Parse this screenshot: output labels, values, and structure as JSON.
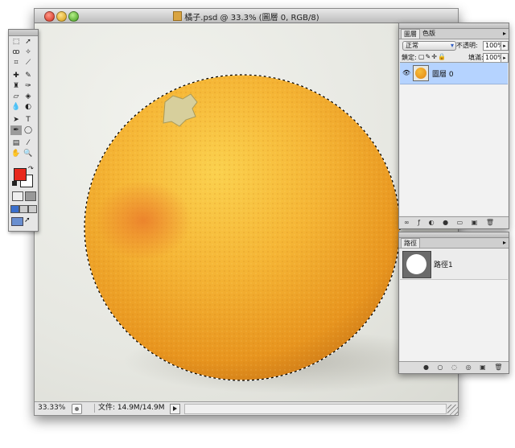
{
  "document": {
    "title": "橘子.psd @ 33.3% (圖層 0, RGB/8)",
    "zoom": "33.33%",
    "file_info": "文件: 14.9M/14.9M"
  },
  "tools": {
    "foreground_color": "#e8281d",
    "background_color": "#ffffff"
  },
  "layers_panel": {
    "tab_active": "圖層",
    "tab_other": "色版",
    "blend_mode": "正常",
    "opacity_label": "不透明:",
    "opacity_value": "100%",
    "lock_label": "鎖定:",
    "fill_label": "填滿:",
    "fill_value": "100%",
    "layers": [
      {
        "name": "圖層 0",
        "selected": true
      }
    ]
  },
  "paths_panel": {
    "tab": "路徑",
    "paths": [
      {
        "name": "路徑1"
      }
    ]
  },
  "image": {
    "subject_color": "#f2a42a",
    "highlight_color": "#f9c84a",
    "shade_color": "#d9861c"
  }
}
